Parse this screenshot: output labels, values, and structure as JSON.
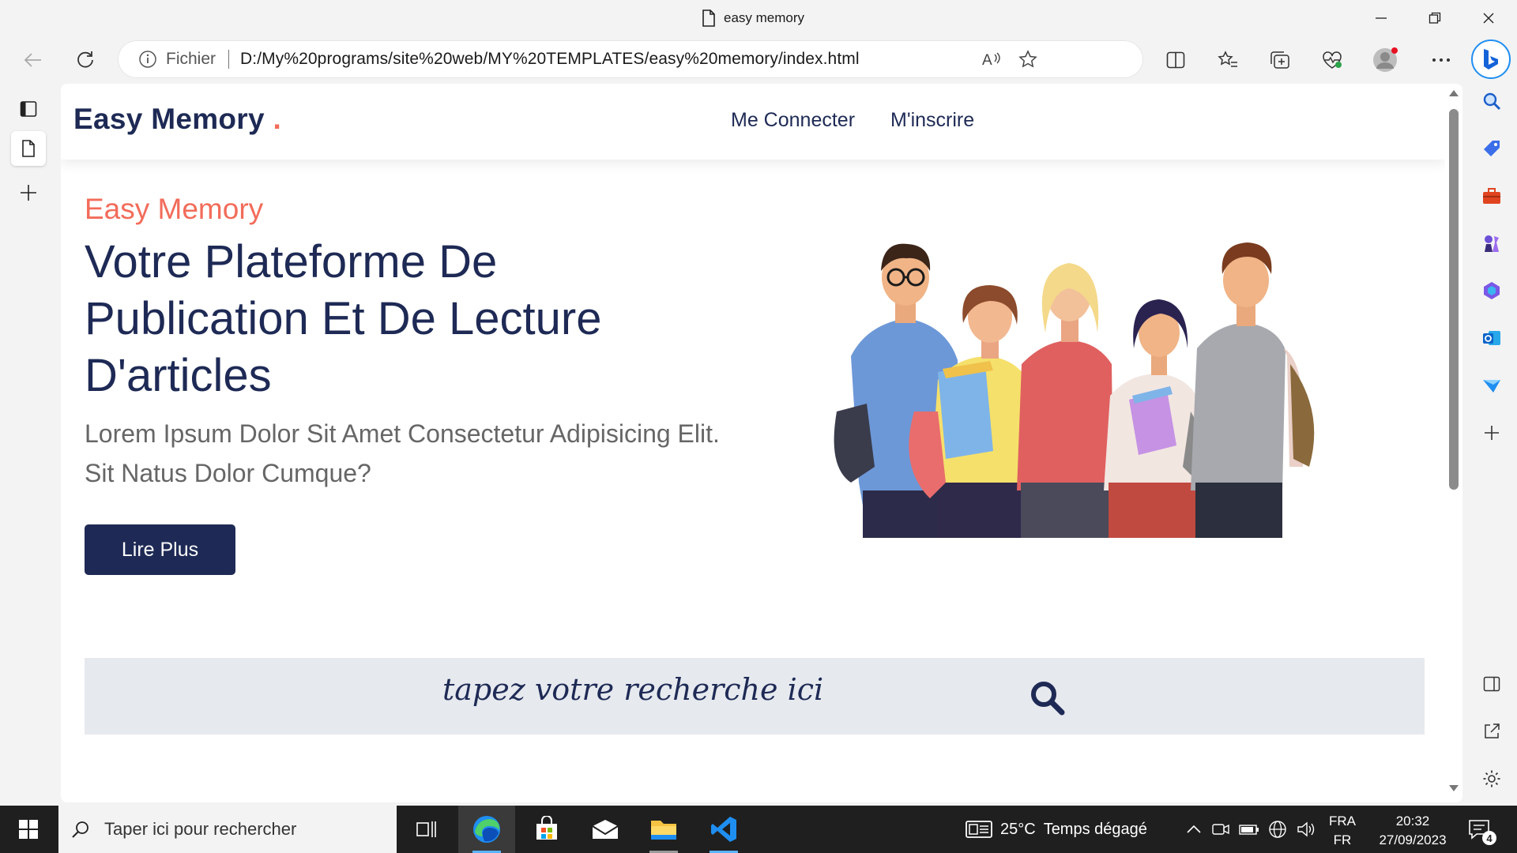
{
  "browser": {
    "tab_title": "easy memory",
    "address": {
      "scheme_label": "Fichier",
      "url": "D:/My%20programs/site%20web/MY%20TEMPLATES/easy%20memory/index.html"
    }
  },
  "site": {
    "logo": "Easy Memory",
    "logo_dot": ".",
    "nav": [
      "Me Connecter",
      "M'inscrire"
    ],
    "hero": {
      "kicker": "Easy Memory",
      "title": "Votre Plateforme De Publication Et De Lecture D'articles",
      "text": "Lorem Ipsum Dolor Sit Amet Consectetur Adipisicing Elit. Sit Natus Dolor Cumque?",
      "button": "Lire Plus"
    },
    "search": {
      "text": "tapez votre recherche ici"
    }
  },
  "taskbar": {
    "search_placeholder": "Taper ici pour rechercher",
    "weather": {
      "temp": "25°C",
      "desc": "Temps dégagé"
    },
    "lang_top": "FRA",
    "lang_bottom": "FR",
    "time": "20:32",
    "date": "27/09/2023",
    "notif_count": "4"
  },
  "colors": {
    "brand": "#1e2a55",
    "accent": "#f26c5a",
    "search_bg": "#e6e9ee"
  }
}
